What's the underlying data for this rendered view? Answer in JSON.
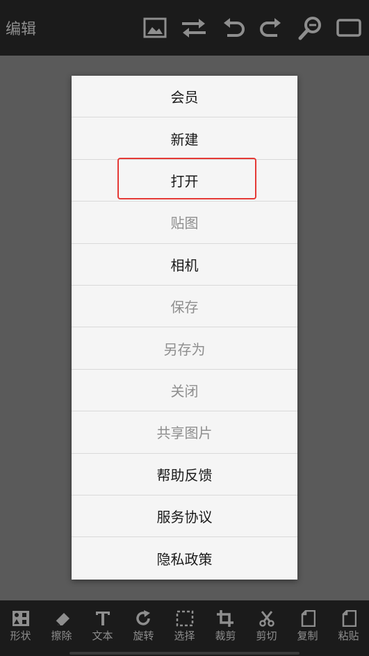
{
  "header": {
    "title": "编辑",
    "icons": [
      "image-icon",
      "swap-icon",
      "undo-icon",
      "redo-icon",
      "zoom-icon",
      "canvas-frame-icon"
    ]
  },
  "menu": {
    "items": [
      {
        "label": "会员",
        "enabled": true
      },
      {
        "label": "新建",
        "enabled": true
      },
      {
        "label": "打开",
        "enabled": true,
        "highlighted": true
      },
      {
        "label": "贴图",
        "enabled": false
      },
      {
        "label": "相机",
        "enabled": true
      },
      {
        "label": "保存",
        "enabled": false
      },
      {
        "label": "另存为",
        "enabled": false
      },
      {
        "label": "关闭",
        "enabled": false
      },
      {
        "label": "共享图片",
        "enabled": false
      },
      {
        "label": "帮助反馈",
        "enabled": true
      },
      {
        "label": "服务协议",
        "enabled": true
      },
      {
        "label": "隐私政策",
        "enabled": true
      }
    ],
    "highlight_color": "#e53935"
  },
  "toolbar": {
    "items": [
      {
        "label": "形状",
        "icon": "shapes-icon"
      },
      {
        "label": "擦除",
        "icon": "eraser-icon"
      },
      {
        "label": "文本",
        "icon": "text-icon"
      },
      {
        "label": "旋转",
        "icon": "rotate-icon"
      },
      {
        "label": "选择",
        "icon": "selection-icon"
      },
      {
        "label": "裁剪",
        "icon": "crop-icon"
      },
      {
        "label": "剪切",
        "icon": "scissors-icon"
      },
      {
        "label": "复制",
        "icon": "copy-icon"
      },
      {
        "label": "粘贴",
        "icon": "paste-icon"
      }
    ]
  },
  "colors": {
    "bar_background": "#1b1b1b",
    "canvas_background": "#5a5a5a",
    "menu_background": "#f5f5f5",
    "icon_color": "#8e8e8e"
  }
}
